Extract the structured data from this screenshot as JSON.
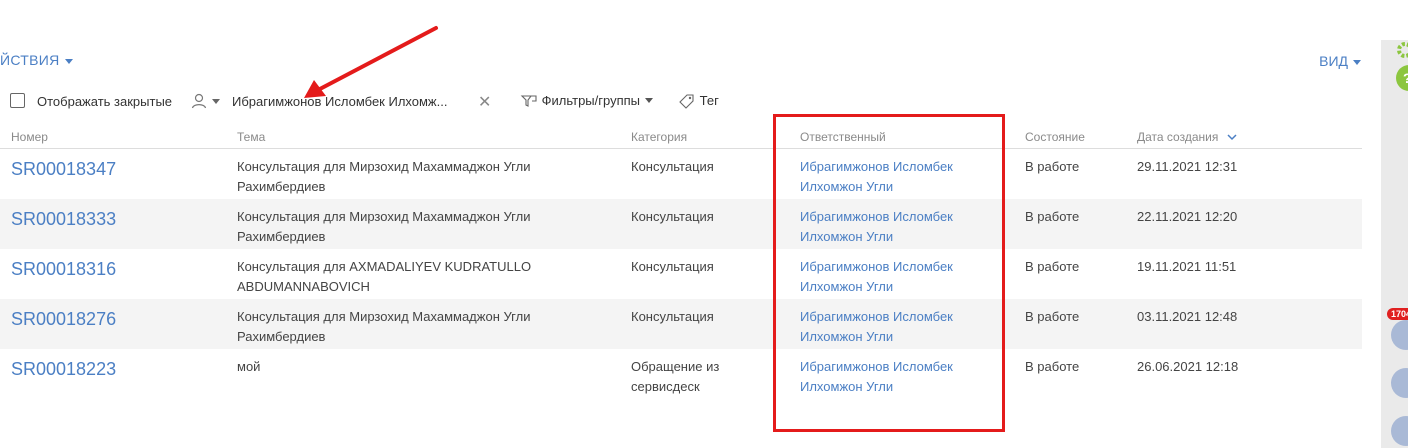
{
  "header": {
    "actions_label": "ЙСТВИЯ",
    "view_label": "ВИД"
  },
  "toolbar": {
    "show_closed_label": "Отображать закрытые",
    "user_filter_value": "Ибрагимжонов Исломбек Илхомж...",
    "filters_label": "Фильтры/группы",
    "tag_label": "Тег"
  },
  "table": {
    "columns": [
      "Номер",
      "Тема",
      "Категория",
      "Ответственный",
      "Состояние",
      "Дата создания"
    ],
    "rows": [
      {
        "number": "SR00018347",
        "topic_line1": "Консультация для Мирзохид Махаммаджон Угли",
        "topic_line2": "Рахимбердиев",
        "category_line1": "Консультация",
        "category_line2": "",
        "owner_line1": "Ибрагимжонов Исломбек",
        "owner_line2": "Илхомжон Угли",
        "state": "В работе",
        "date": "29.11.2021 12:31"
      },
      {
        "number": "SR00018333",
        "topic_line1": "Консультация для Мирзохид Махаммаджон Угли",
        "topic_line2": "Рахимбердиев",
        "category_line1": "Консультация",
        "category_line2": "",
        "owner_line1": "Ибрагимжонов Исломбек",
        "owner_line2": "Илхомжон Угли",
        "state": "В работе",
        "date": "22.11.2021 12:20"
      },
      {
        "number": "SR00018316",
        "topic_line1": "Консультация для AXMADALIYEV KUDRATULLO",
        "topic_line2": "ABDUMANNABOVICH",
        "category_line1": "Консультация",
        "category_line2": "",
        "owner_line1": "Ибрагимжонов Исломбек",
        "owner_line2": "Илхомжон Угли",
        "state": "В работе",
        "date": "19.11.2021 11:51"
      },
      {
        "number": "SR00018276",
        "topic_line1": "Консультация для Мирзохид Махаммаджон Угли",
        "topic_line2": "Рахимбердиев",
        "category_line1": "Консультация",
        "category_line2": "",
        "owner_line1": "Ибрагимжонов Исломбек",
        "owner_line2": "Илхомжон Угли",
        "state": "В работе",
        "date": "03.11.2021 12:48"
      },
      {
        "number": "SR00018223",
        "topic_line1": "мой",
        "topic_line2": "",
        "category_line1": "Обращение из",
        "category_line2": "сервисдеск",
        "owner_line1": "Ибрагимжонов Исломбек",
        "owner_line2": "Илхомжон Угли",
        "state": "В работе",
        "date": "26.06.2021 12:18"
      }
    ]
  },
  "sidebar": {
    "badge_count": "1704"
  },
  "colors": {
    "link": "#4b7fc4",
    "annotation": "#e41b1b"
  },
  "icons": [
    "user-icon",
    "filter-icon",
    "tag-icon",
    "close-icon",
    "sort-down-icon",
    "settings-icon",
    "help-icon",
    "user-avatar-icon",
    "mail-icon",
    "chat-icon"
  ]
}
